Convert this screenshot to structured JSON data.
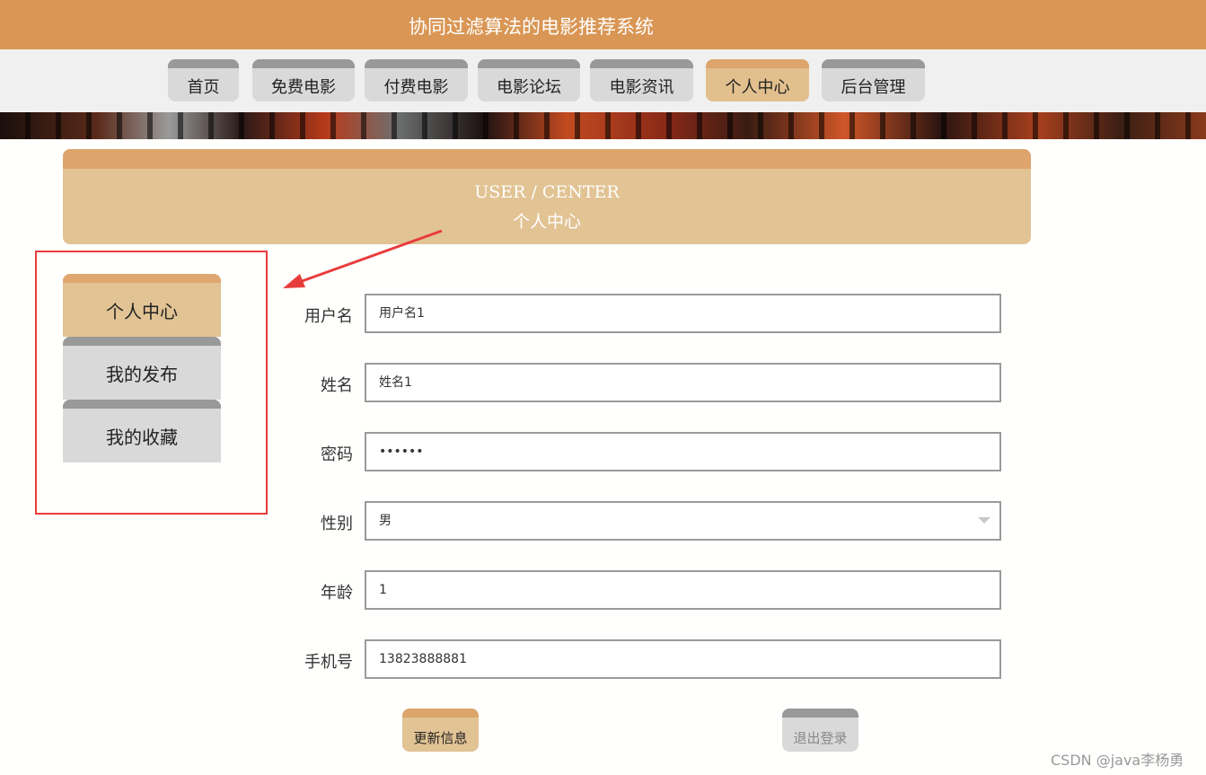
{
  "header": {
    "site_title": "协同过滤算法的电影推荐系统"
  },
  "nav": {
    "items": [
      {
        "label": "首页",
        "active": false
      },
      {
        "label": "免费电影",
        "active": false
      },
      {
        "label": "付费电影",
        "active": false
      },
      {
        "label": "电影论坛",
        "active": false
      },
      {
        "label": "电影资讯",
        "active": false
      },
      {
        "label": "个人中心",
        "active": true
      },
      {
        "label": "后台管理",
        "active": false
      }
    ]
  },
  "section": {
    "title_en": "USER / CENTER",
    "title_cn": "个人中心"
  },
  "sidebar": {
    "items": [
      {
        "label": "个人中心",
        "active": true
      },
      {
        "label": "我的发布",
        "active": false
      },
      {
        "label": "我的收藏",
        "active": false
      }
    ]
  },
  "form": {
    "username": {
      "label": "用户名",
      "value": "用户名1"
    },
    "name": {
      "label": "姓名",
      "value": "姓名1"
    },
    "password": {
      "label": "密码",
      "value": "••••••"
    },
    "gender": {
      "label": "性别",
      "value": "男"
    },
    "age": {
      "label": "年龄",
      "value": "1"
    },
    "phone": {
      "label": "手机号",
      "value": "13823888881"
    }
  },
  "buttons": {
    "update": "更新信息",
    "logout": "退出登录"
  },
  "watermark": "CSDN @java李杨勇",
  "colors": {
    "accent": "#d99654",
    "accent_light": "#e2c394",
    "annotation": "#e83c3c"
  }
}
